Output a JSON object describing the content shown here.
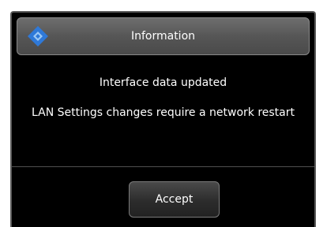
{
  "dialog": {
    "title": "Information",
    "icon": "blue-diamond-logo-icon",
    "messages": {
      "line1": "Interface data updated",
      "line2": "LAN Settings changes require a network restart"
    },
    "accept_label": "Accept"
  },
  "colors": {
    "background": "#000000",
    "text": "#ffffff",
    "icon_blue": "#2f79d8"
  }
}
